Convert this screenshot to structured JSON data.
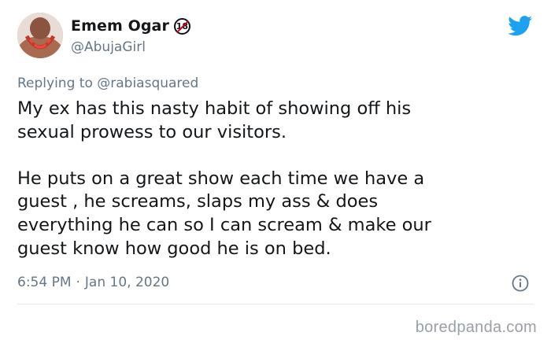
{
  "author": {
    "display_name": "Emem Ogar",
    "badge_text": "18",
    "handle": "@AbujaGirl"
  },
  "reply": {
    "prefix": "Replying to",
    "mention": "@rabiasquared"
  },
  "tweet": {
    "text": "My ex has this nasty habit of showing off his\nsexual prowess to our visitors.\n\nHe puts on a great show each time we have a\nguest , he screams, slaps my ass & does\neverything he can so I can scream & make our\nguest know how good he is on bed."
  },
  "meta": {
    "time": "6:54 PM",
    "separator": "·",
    "date": "Jan 10, 2020"
  },
  "icons": {
    "brand": "twitter-bird-icon",
    "info": "info-icon"
  },
  "colors": {
    "twitter_blue": "#1da1f2",
    "secondary_text": "#657786",
    "divider": "#e1e8ed"
  },
  "watermark": "boredpanda.com"
}
